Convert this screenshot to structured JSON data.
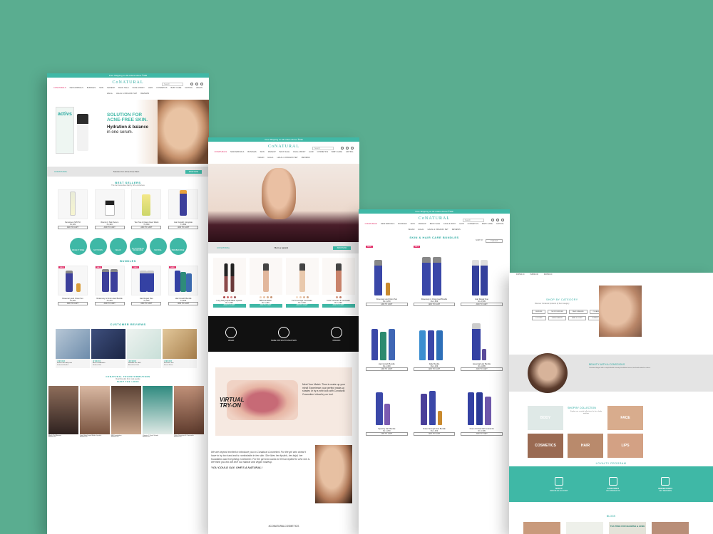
{
  "brand": "CoNATURAL",
  "colors": {
    "background": "#5aad90",
    "accent": "#3fb8a6",
    "highlight": "#e2336b"
  },
  "announcement": "Free Shipping on All orders Above ₹499",
  "search_placeholder": "Search",
  "nav": [
    "CONATURALS",
    "NEW ARRIVALS",
    "BUNDLES",
    "SKIN",
    "MAKEUP",
    "BACK SALE",
    "FACE & BODY",
    "HAIR",
    "COSMETICS",
    "BABY CARE",
    "GIFTING",
    "VEGAN",
    "HALAL",
    "HALAL & ORGANIC SET",
    "REVIEWS"
  ],
  "home": {
    "hero": {
      "box_label": "activs",
      "headline_1": "SOLUTION FOR",
      "headline_2": "ACNE-FREE SKIN.",
      "sub_1": "Hydration & balance",
      "sub_2": "in one serum."
    },
    "strip": {
      "left": "CONATURAL",
      "center": "Solution for Acne-Free Skin",
      "button": "SHOP NOW"
    },
    "bestsellers": {
      "title": "BEST SELLERS",
      "subtitle": "The fan favourites that fly off our shelves",
      "products": [
        {
          "name": "Sunscreen SPF 50",
          "price": "₹2,309",
          "cta": "ADD TO CART"
        },
        {
          "name": "Vitamin C Skin Serum",
          "price": "₹1,399",
          "cta": "ADD TO CART"
        },
        {
          "name": "Tea Tree & Neem Face Wash",
          "price": "₹1,899",
          "cta": "ADD TO CART"
        },
        {
          "name": "Hair Growth Complete",
          "price": "₹1,899",
          "cta": "ADD TO CART"
        }
      ]
    },
    "badges": [
      "CRUELTY FREE",
      "NO TOXINS",
      "VEGAN",
      "NO SYNTHETIC FRAGRANCE",
      "NATURAL",
      "PARABEN FREE"
    ],
    "bundles": {
      "title": "BUNDLES",
      "products": [
        {
          "name": "Rosemary and Onion Set",
          "price": "₹1,999",
          "cta": "ADD TO CART",
          "tag": "SALE"
        },
        {
          "name": "Rosemary & Onion Hair Bundle",
          "price": "₹2,299",
          "cta": "ADD TO CART",
          "tag": "SALE"
        },
        {
          "name": "Hair Repair Duo",
          "price": "₹1,599",
          "cta": "ADD TO CART",
          "tag": "SALE"
        },
        {
          "name": "Hair Growth Bundle",
          "price": "₹2,499",
          "cta": "ADD TO CART",
          "tag": "SALE"
        }
      ]
    },
    "reviews": {
      "title": "CUSTOMER REVIEWS",
      "items": [
        {
          "title": "Perfect for daily use",
          "author": "Prakash Mandal"
        },
        {
          "title": "Best Conditioner",
          "author": "Nudeen Bali"
        },
        {
          "title": "Suitable for skin!",
          "author": "Akanksha Dalvi"
        },
        {
          "title": "Precious use",
          "author": "Kaveri Khare"
        }
      ]
    },
    "transformations": {
      "title": "CONATURAL TRANSFORMATIONS",
      "subtitle": "Real Results from real people",
      "cta": "SHOP THE LOOK"
    },
    "looks": [
      {
        "name": "Blush Tint Mimosa",
        "price": "INR500.00"
      },
      {
        "name": "Long Stay Liquid Matte Lipstick",
        "price": "INR500.00"
      },
      {
        "name": "BB Foundation",
        "price": "INR500.00"
      },
      {
        "name": "Vitamin C Kajal Shade",
        "price": "INR500.00"
      },
      {
        "name": "Color Corrector & Concealer",
        "price": "INR500.00"
      }
    ]
  },
  "makeup": {
    "strip": {
      "left": "CONATURAL",
      "center": "Born a natural",
      "button": "SHOP NOW"
    },
    "products": [
      {
        "name": "Long Stay Liquid Matte Lipstick",
        "price": "Rs.1,099",
        "cta": "ADD TO CART"
      },
      {
        "name": "BB Foundation",
        "price": "Rs.1,299",
        "cta": "ADD TO CART"
      },
      {
        "name": "Full Coverage Concealer",
        "price": "Rs.1,099",
        "cta": "ADD TO CART"
      },
      {
        "name": "Color Corrector & Concealer",
        "price": "Rs.1,199",
        "cta": "ADD TO CART"
      }
    ],
    "features": [
      "VEGAN",
      "MADE FOR SOUTH ASIAN SKIN",
      "ORGANIC"
    ],
    "tryon": {
      "title_1": "VIRTUAL",
      "title_2": "TRY-ON",
      "text": "Meet Your Match: Time to make up your mind! Experience your perfect make-up shades or try a new look with Conatural Cosmetics' virtual try-on tool."
    },
    "para": "We are beyond excited to introduce you to Conatural Cosmetics! For the girl who doesn't have to try too hard and is comfortable in her skin. She likes her lipstick, her kajal, her foundation and everything in between. For the girl who wants to feel accepted for who she is. We think you too will love our natural and vegan makeup.",
    "tagline": "YOU COULD SAY, SHE'S A NATURAL!",
    "hashtag": "#CONATURALCOSMETICS"
  },
  "bundles_page": {
    "title": "SKIN & HAIR CARE BUNDLES",
    "sort_label": "SORT BY",
    "sort_value": "Featured",
    "products": [
      {
        "name": "Rosemary and Onion Set",
        "price": "Rs.1,299",
        "cta": "ADD TO CART"
      },
      {
        "name": "Rosemary & Onion Hair Bundle",
        "price": "Rs.1,899",
        "cta": "ADD TO CART"
      },
      {
        "name": "Hair Repair Duo",
        "price": "Rs.1,599",
        "cta": "ADD TO CART"
      },
      {
        "name": "Hair Growth Bundle",
        "price": "Rs.1,499",
        "cta": "ADD TO CART"
      },
      {
        "name": "Daily Bundle",
        "price": "Rs.1,199",
        "cta": "ADD TO CART"
      },
      {
        "name": "Essential Hair Bundle",
        "price": "Rs.1,899",
        "cta": "ADD TO CART"
      },
      {
        "name": "Spa Day Hair Bundle",
        "price": "Rs.1,299",
        "cta": "ADD TO CART"
      },
      {
        "name": "Onion Strength Hair Bundle",
        "price": "Rs.1,499",
        "cta": "ADD TO CART"
      },
      {
        "name": "Onion Oil Hair Fall Control Kit",
        "price": "Rs.1,399",
        "cta": "ADD TO CART"
      }
    ]
  },
  "about": {
    "top": [
      "INR500.00",
      "INR500.00",
      "INR500.00"
    ],
    "shop_by_category": "SHOP BY CATEGORY",
    "category_sub": "Discover Conatural products by their category",
    "categories": [
      "SERUMS",
      "MOISTURIZERS",
      "FACE WASHES",
      "CLEANSERS",
      "LOTIONS",
      "SUNSCREENS",
      "HAIR & SCALP",
      "COMBOS"
    ],
    "founders_title": "BEAUTY WITH A CONSCIOUS",
    "founders_text": "Conatural began with a simple belief: beauty should be honest, kind and rooted in nature.",
    "shop_by_collection": "SHOP BY COLLECTION",
    "collection_text": "Explore our curated collections for face, body and hair",
    "collections": [
      "BODY",
      "FACE",
      "COSMETICS",
      "HAIR",
      "LIPS"
    ],
    "loyalty_title": "LOYALTY PROGRAM",
    "loyalty": [
      {
        "label": "SIGN UP",
        "sub": "CREATE AN ACCOUNT"
      },
      {
        "label": "EARN POINTS",
        "sub": "BUY PRODUCTS"
      },
      {
        "label": "REDEEM POINTS",
        "sub": "GET REWARDS"
      }
    ],
    "blog_title": "BLOGS",
    "blog_card": "TEA TREE FOR BLEMISH & ACNE"
  }
}
